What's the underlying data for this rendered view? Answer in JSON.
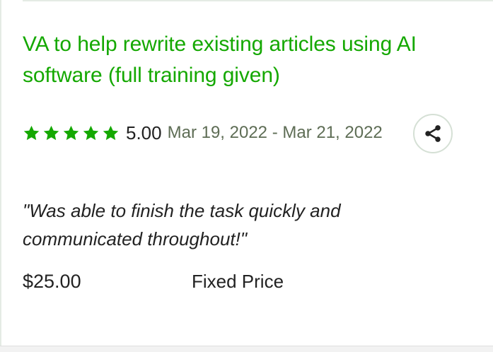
{
  "job": {
    "title": "VA to help rewrite existing articles using AI software (full training given)",
    "rating": {
      "value": "5.00",
      "stars_filled": 5,
      "stars_total": 5,
      "star_color": "#14a800"
    },
    "date_range": "Mar 19, 2022 - Mar 21, 2022",
    "share": {
      "icon": "share-icon"
    },
    "feedback": "\"Was able to finish the task quickly and communicated throughout!\"",
    "price": "$25.00",
    "price_type": "Fixed Price"
  },
  "colors": {
    "accent": "#14a800",
    "text": "#222222",
    "muted": "#5e6d55",
    "divider": "#e4ebe4"
  }
}
